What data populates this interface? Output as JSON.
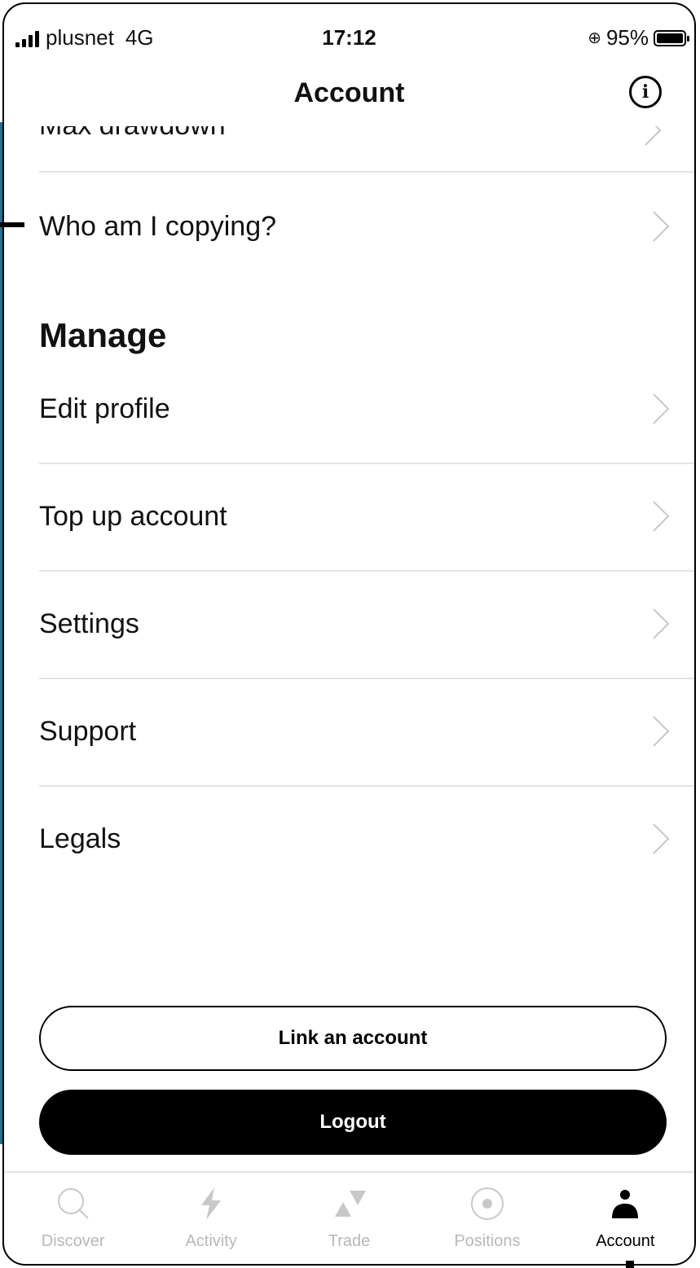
{
  "status_bar": {
    "carrier": "plusnet",
    "network": "4G",
    "time": "17:12",
    "battery_percent": "95%"
  },
  "header": {
    "title": "Account"
  },
  "partial_row_label": "Max drawdown",
  "rows_top": [
    {
      "label": "Who am I copying?"
    }
  ],
  "manage": {
    "title": "Manage",
    "items": [
      {
        "label": "Edit profile"
      },
      {
        "label": "Top up account"
      },
      {
        "label": "Settings"
      },
      {
        "label": "Support"
      },
      {
        "label": "Legals"
      }
    ]
  },
  "buttons": {
    "link_account": "Link an account",
    "logout": "Logout"
  },
  "tabs": [
    {
      "label": "Discover",
      "icon": "search-icon",
      "active": false
    },
    {
      "label": "Activity",
      "icon": "lightning-icon",
      "active": false
    },
    {
      "label": "Trade",
      "icon": "trade-icon",
      "active": false
    },
    {
      "label": "Positions",
      "icon": "positions-icon",
      "active": false
    },
    {
      "label": "Account",
      "icon": "person-icon",
      "active": true
    }
  ],
  "colors": {
    "accent": "#000000",
    "inactive_tab": "#b8b8b8",
    "divider": "#e4e4e4",
    "left_bar": "#2e6b8c"
  }
}
